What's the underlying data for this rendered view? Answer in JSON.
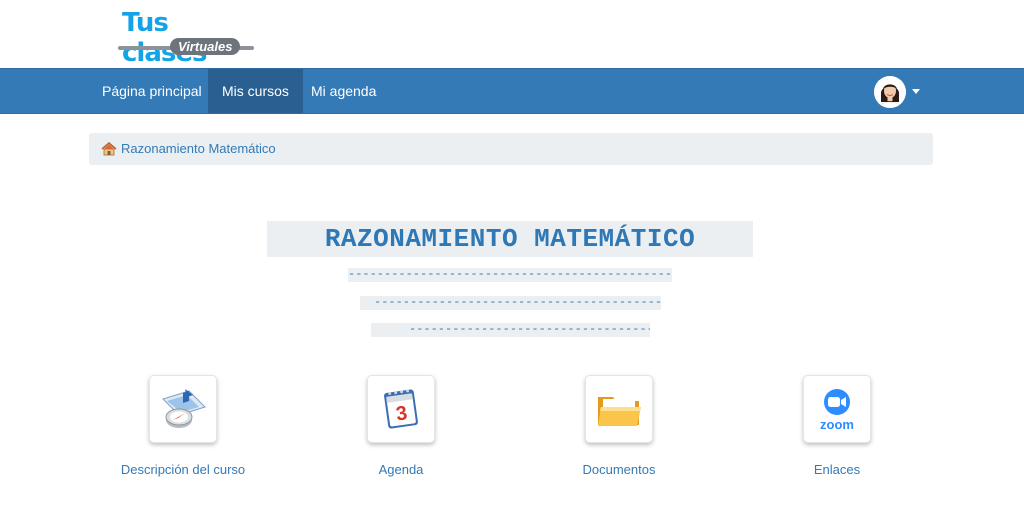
{
  "logo": {
    "line1": "Tus clases",
    "line2": "Virtuales"
  },
  "nav": {
    "items": [
      {
        "label": "Página principal"
      },
      {
        "label": "Mis cursos"
      },
      {
        "label": "Mi agenda"
      }
    ],
    "active_index": 1
  },
  "breadcrumb": {
    "label": "Razonamiento Matemático",
    "icon": "home-icon"
  },
  "course": {
    "title": "RAZONAMIENTO MATEMÁTICO",
    "dashes1": "---------------------------------------------",
    "dashes2": "----------------------------------------",
    "dashes3": "------------------------------------"
  },
  "tools": [
    {
      "label": "Descripción del curso",
      "icon": "compass-icon"
    },
    {
      "label": "Agenda",
      "icon": "calendar-icon",
      "icon_text": "3"
    },
    {
      "label": "Documentos",
      "icon": "folder-icon"
    },
    {
      "label": "Enlaces",
      "icon": "zoom-icon",
      "icon_text": "zoom"
    }
  ],
  "colors": {
    "navbar": "#337ab7",
    "link": "#337ab7",
    "title": "#2f78b6",
    "panel": "#eceff1",
    "logo": "#13a3e6"
  }
}
